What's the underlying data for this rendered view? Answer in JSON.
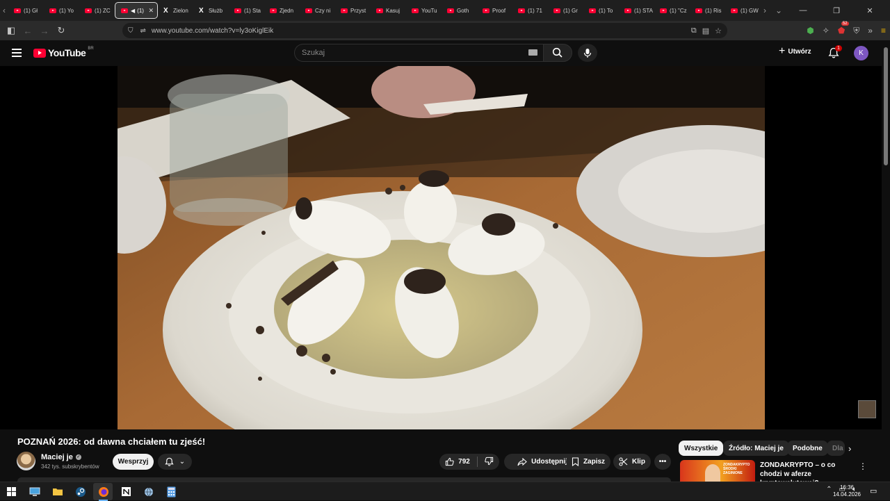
{
  "browser": {
    "tabs": [
      {
        "label": "(1) Gł",
        "icon": "youtube-icon"
      },
      {
        "label": "(1) Yo",
        "icon": "youtube-icon"
      },
      {
        "label": "(1) ZC",
        "icon": "youtube-icon"
      },
      {
        "label": "(1) ",
        "icon": "youtube-icon",
        "active": true
      },
      {
        "label": "Zielon",
        "icon": "x-icon"
      },
      {
        "label": "Służb",
        "icon": "x-icon"
      },
      {
        "label": "(1) Sta",
        "icon": "youtube-icon"
      },
      {
        "label": "Zjedn",
        "icon": "youtube-icon"
      },
      {
        "label": "Czy ni",
        "icon": "youtube-icon"
      },
      {
        "label": "Przyst",
        "icon": "youtube-icon"
      },
      {
        "label": "Kasuj",
        "icon": "youtube-icon"
      },
      {
        "label": "YouTu",
        "icon": "youtube-icon"
      },
      {
        "label": "Goth",
        "icon": "youtube-icon"
      },
      {
        "label": "Proof",
        "icon": "youtube-icon"
      },
      {
        "label": "(1) 71",
        "icon": "youtube-icon"
      },
      {
        "label": "(1) Gr",
        "icon": "youtube-icon"
      },
      {
        "label": "(1) To",
        "icon": "youtube-icon"
      },
      {
        "label": "(1) STA",
        "icon": "youtube-icon"
      },
      {
        "label": "(1) \"Cz",
        "icon": "youtube-icon"
      },
      {
        "label": "(1) Ris",
        "icon": "youtube-icon"
      },
      {
        "label": "(1) GW",
        "icon": "youtube-icon"
      }
    ],
    "url": "www.youtube.com/watch?v=ly3oKiglEik",
    "extension_badge": "52"
  },
  "youtube": {
    "logo_text": "YouTube",
    "country_code": "BR",
    "search_placeholder": "Szukaj",
    "create_label": "Utwórz",
    "notification_count": "1",
    "avatar_letter": "K"
  },
  "video": {
    "title": "POZNAŃ 2026: od dawna chciałem tu zjeść!",
    "channel_name": "Maciej je",
    "subscribers": "342 tys. subskrybentów",
    "support_label": "Wesprzyj",
    "likes": "792",
    "share_label": "Udostępnij",
    "save_label": "Zapisz",
    "clip_label": "Klip"
  },
  "related": {
    "chips": [
      "Wszystkie",
      "Źródło: Maciej je",
      "Podobne",
      "Dla"
    ],
    "first_title": "ZONDAKRYPTO – o co chodzi w aferze kryptowalutowej?",
    "first_thumb_text": "ZONDAKRYPTO ŚRODKI ZAGINIONE"
  },
  "taskbar": {
    "time": "16:36",
    "date": "14.04.2026"
  },
  "colors": {
    "youtube_red": "#ff0033",
    "background": "#0f0f0f",
    "avatar_purple": "#7e57c2"
  }
}
